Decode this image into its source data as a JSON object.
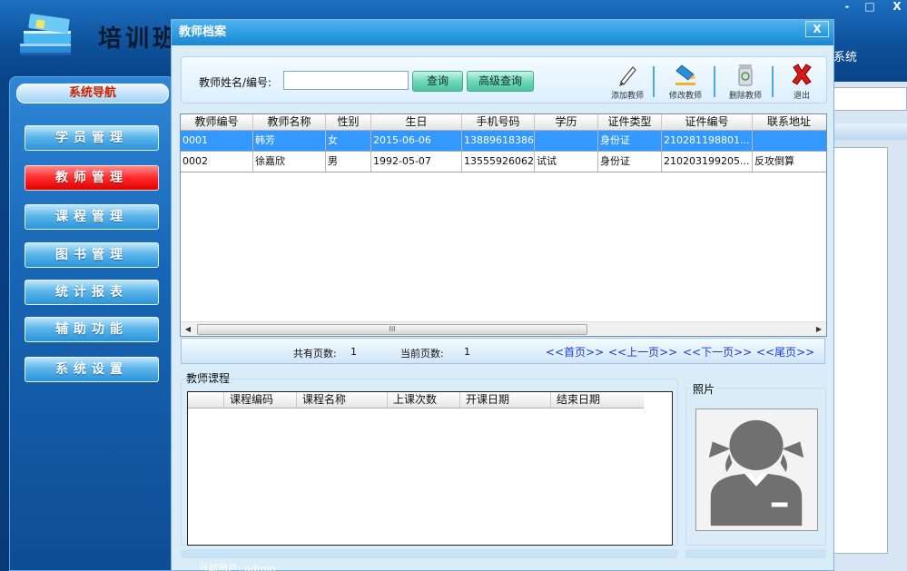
{
  "app": {
    "title": "培训班",
    "system_fragment": "系统",
    "window_controls": {
      "minimize": "-",
      "maximize": "□",
      "close": "X"
    },
    "status_bar": "当前用户: admin"
  },
  "nav": {
    "heading": "系统导航",
    "items": [
      {
        "label": "学员管理",
        "active": false
      },
      {
        "label": "教师管理",
        "active": true
      },
      {
        "label": "课程管理",
        "active": false
      },
      {
        "label": "图书管理",
        "active": false
      },
      {
        "label": "统计报表",
        "active": false
      },
      {
        "label": "辅助功能",
        "active": false
      },
      {
        "label": "系统设置",
        "active": false
      }
    ]
  },
  "dialog": {
    "title": "教师档案",
    "close_label": "X",
    "search": {
      "label": "教师姓名/编号:",
      "value": "",
      "query_button": "查询",
      "advanced_button": "高级查询"
    },
    "toolbar": {
      "add": "添加教师",
      "edit": "修改教师",
      "delete": "删除教师",
      "exit": "退出"
    },
    "teacher_table": {
      "columns": [
        "教师编号",
        "教师名称",
        "性别",
        "生日",
        "手机号码",
        "学历",
        "证件类型",
        "证件编号",
        "联系地址"
      ],
      "rows": [
        [
          "0001",
          "韩芳",
          "女",
          "2015-06-06",
          "13889618386",
          "",
          "身份证",
          "210281198801...",
          ""
        ],
        [
          "0002",
          "徐嘉欣",
          "男",
          "1992-05-07",
          "13555926062",
          "试试",
          "身份证",
          "210203199205...",
          "反攻倒算"
        ]
      ],
      "selected_row": 0,
      "scroll_thumb": "III"
    },
    "pager": {
      "total_pages_label": "共有页数:",
      "total_pages": "1",
      "current_page_label": "当前页数:",
      "current_page": "1",
      "first": "<<首页>>",
      "prev": "<<上一页>>",
      "next": "<<下一页>>",
      "last": "<<尾页>>"
    },
    "course_section": {
      "label": "教师课程",
      "columns": [
        "课程编码",
        "课程名称",
        "上课次数",
        "开课日期",
        "结束日期"
      ]
    },
    "photo_section": {
      "label": "照片"
    }
  },
  "colors": {
    "accent": "#2a9ae0",
    "selected_row": "#3399ff",
    "nav_active": "#ff2a2a",
    "link": "#1c3ccf"
  }
}
